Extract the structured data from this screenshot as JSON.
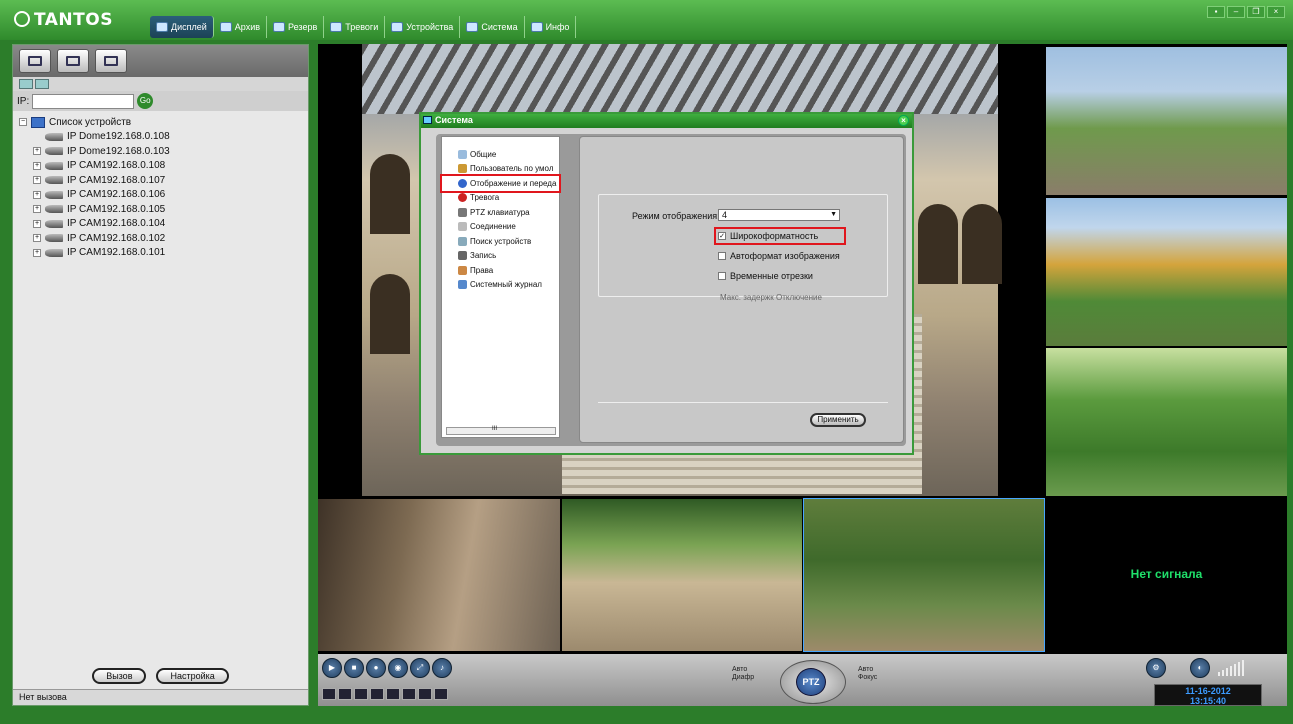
{
  "app": {
    "logo": "TANTOS"
  },
  "menu": [
    {
      "label": "Дисплей",
      "icon": "display-icon"
    },
    {
      "label": "Архив",
      "icon": "archive-icon"
    },
    {
      "label": "Резерв",
      "icon": "backup-icon"
    },
    {
      "label": "Тревоги",
      "icon": "alarm-icon"
    },
    {
      "label": "Устройства",
      "icon": "devices-icon"
    },
    {
      "label": "Система",
      "icon": "system-icon"
    },
    {
      "label": "Инфо",
      "icon": "info-icon"
    }
  ],
  "window_buttons": [
    "▪",
    "–",
    "❐",
    "×"
  ],
  "left": {
    "ip_label": "IP:",
    "ip_value": "",
    "go_label": "Go",
    "tree_root": "Список устройств",
    "devices": [
      "IP Dome192.168.0.108",
      "IP Dome192.168.0.103",
      "IP CAM192.168.0.108",
      "IP CAM192.168.0.107",
      "IP CAM192.168.0.106",
      "IP CAM192.168.0.105",
      "IP CAM192.168.0.104",
      "IP CAM192.168.0.102",
      "IP CAM192.168.0.101"
    ],
    "call_button": "Вызов",
    "settings_button": "Настройка",
    "status": "Нет вызова"
  },
  "video": {
    "no_signal": "Нет сигнала"
  },
  "controls": {
    "auto_aperture": "Авто Диафр",
    "auto_focus": "Авто Фокус",
    "ptz": "PTZ",
    "date": "11-16-2012",
    "time": "13:15:40"
  },
  "dialog": {
    "title": "Система",
    "tree": [
      "Общие",
      "Пользователь по умол",
      "Отображение и переда",
      "Тревога",
      "PTZ клавиатура",
      "Соединение",
      "Поиск устройств",
      "Запись",
      "Права",
      "Системный журнал"
    ],
    "scroll_mark": "III",
    "mode_label": "Режим отображения:",
    "mode_value": "4",
    "options": [
      {
        "label": "Широкоформатность",
        "checked": true
      },
      {
        "label": "Автоформат изображения",
        "checked": false
      },
      {
        "label": "Временные отрезки",
        "checked": false
      }
    ],
    "partial_text": "Макс. задержк     Отключение",
    "apply_button": "Применить"
  },
  "colors": {
    "accent_green": "#2f8a2c",
    "highlight_red": "#e0161d",
    "no_signal_green": "#1fe06a",
    "clock_blue": "#3c9bff"
  }
}
